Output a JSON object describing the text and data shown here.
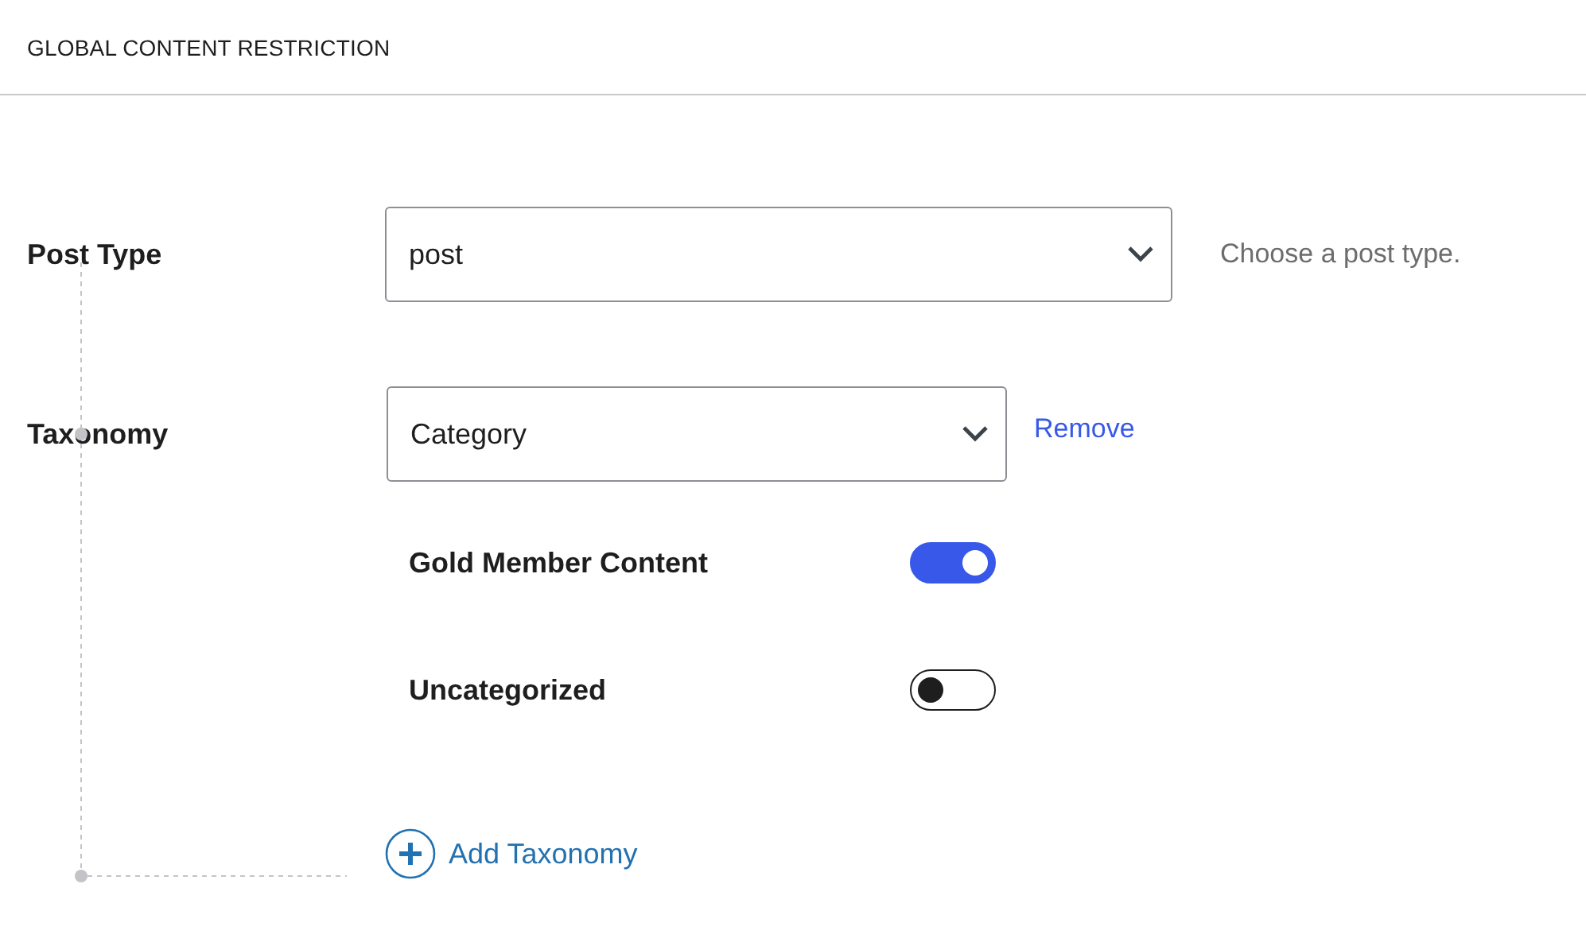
{
  "header": {
    "title": "GLOBAL CONTENT RESTRICTION"
  },
  "post_type": {
    "label": "Post Type",
    "value": "post",
    "help": "Choose a post type."
  },
  "taxonomy": {
    "label": "Taxonomy",
    "value": "Category",
    "remove": "Remove"
  },
  "terms": [
    {
      "label": "Gold Member Content",
      "on": true
    },
    {
      "label": "Uncategorized",
      "on": false
    }
  ],
  "add_taxonomy": {
    "label": "Add Taxonomy"
  }
}
